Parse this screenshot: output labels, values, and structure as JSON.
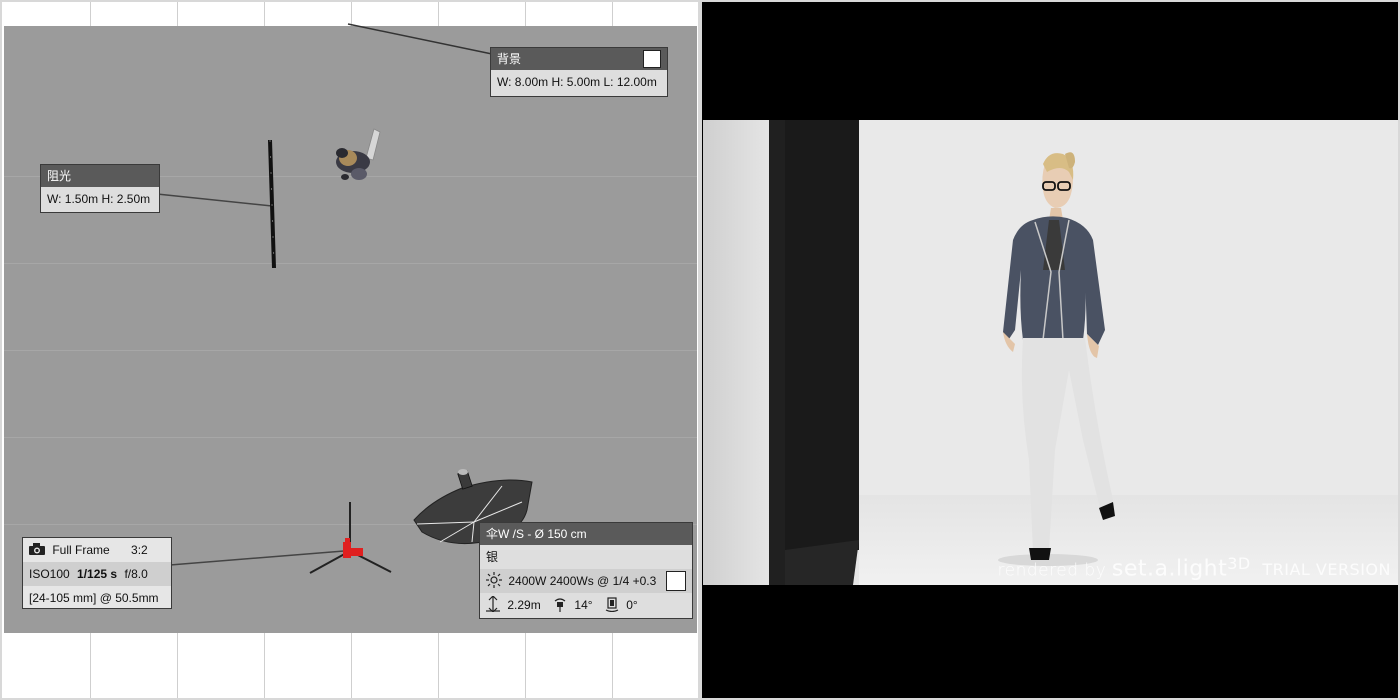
{
  "floor_plan": {
    "background_label": {
      "title": "背景",
      "dims": "W: 8.00m H: 5.00m L: 12.00m",
      "swatch_color": "#ffffff"
    },
    "flag_label": {
      "title": "阻光",
      "dims": "W: 1.50m H: 2.50m"
    },
    "camera_label": {
      "sensor": "Full Frame",
      "ratio": "3:2",
      "iso": "ISO100",
      "shutter": "1/125 s",
      "aperture": "f/8.0",
      "lens": "[24-105 mm] @ 50.5mm"
    },
    "light_label": {
      "title": "伞W /S - Ø 150 cm",
      "modifier": "银",
      "power": "2400W 2400Ws @ 1/4 +0.3",
      "height": "2.29m",
      "tilt": "14°",
      "rotation": "0°",
      "swatch_color": "#ffffff"
    }
  },
  "render_view": {
    "watermark": {
      "rendered_by": "rendered by",
      "brand": "set.a.light",
      "brand_3d": "3D",
      "trial": "TRIAL VERSION"
    }
  }
}
